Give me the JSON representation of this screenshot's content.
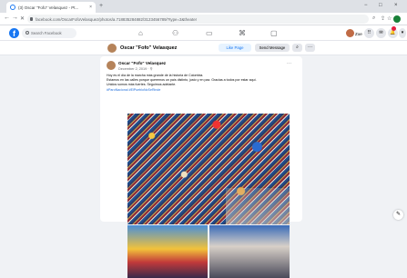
{
  "browser": {
    "tab_title": "(3) Oscar \"Fofo\" Velasquez - Pt...",
    "tab_close": "×",
    "new_tab": "+",
    "window_controls": [
      "−",
      "□",
      "×"
    ],
    "nav": {
      "back": "←",
      "forward": "→",
      "reload": "✕"
    },
    "url": "facebook.com/OscarFofoVelasquez/photos/a.718835284882/3123456789/?type=3&theater",
    "toolbar_icons": [
      "search-icon",
      "share-icon",
      "star-icon",
      "profile-icon"
    ]
  },
  "facebook": {
    "search_placeholder": "Search Facebook",
    "nav_icons": [
      "home-icon",
      "friends-icon",
      "watch-icon",
      "marketplace-icon",
      "groups-icon"
    ],
    "me_name": "Zoe",
    "right_icons": [
      "menu-grid-icon",
      "messenger-icon",
      "notifications-icon",
      "account-icon"
    ],
    "notification_color": "#e41e3f",
    "brand_color": "#1877f2"
  },
  "page_header": {
    "name": "Oscar \"Fofo\" Velasquez",
    "like_label": "Like Page",
    "message_label": "Send Message",
    "search_label": "⌕",
    "more_label": "···"
  },
  "post": {
    "author": "Oscar \"Fofo\" Velasquez",
    "date": "December 2, 2019 · ⚲",
    "more": "···",
    "text_lines": [
      "Hoy es el día de la marcha más grande de la historia de Colombia.",
      "Estamos en las calles porque queremos un país distinto, justo y en paz. Gracias a todos por estar aquí.",
      "Unidos somos más fuertes. Seguimos adelante."
    ],
    "hashtags": "#ParoNacional #ElPuebloNoSeRinde"
  }
}
